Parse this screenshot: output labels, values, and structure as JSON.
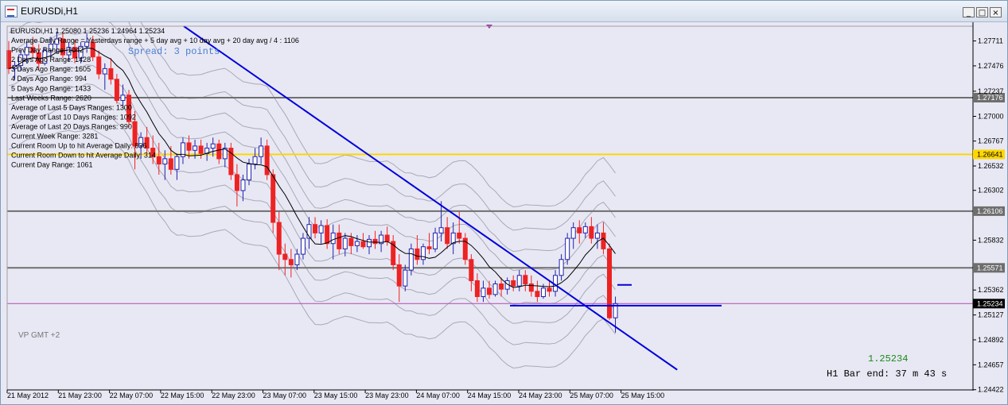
{
  "window": {
    "title": "EURUSDi,H1",
    "buttons": [
      "_",
      "□",
      "×"
    ]
  },
  "ohlc_line": "EURUSDi,H1  1.25080 1.25236 1.24964 1.25234",
  "info_lines": [
    "Average Daily Range = Yesterdays range + 5 day avg + 10 day avg + 20 day avg / 4 : 1106",
    "Prev Day Range: 1042",
    "2 Days Ago Range: 1428",
    "3 Days Ago Range: 1605",
    "4 Days Ago Range: 994",
    "5 Days Ago Range: 1433",
    "Last Weeks Range: 2620",
    "Average of Last 5 Days Ranges: 1300",
    "Average of Last 10 Days Ranges: 1092",
    "Average of Last 20 Days Ranges: 990",
    "Current Week Range: 3281",
    "Current Room Up to hit Average Daily:    836",
    "Current Room Down to hit Average Daily: 314",
    "Current Day Range: 1061"
  ],
  "spread_text": "Spread: 3 points",
  "vp_label": "VP GMT +2",
  "current_price_text": "1.25234",
  "bar_end_text": "H1 Bar end: 37 m 43 s",
  "colors": {
    "background": "#e8e8f4",
    "bull": "#2222aa",
    "bear": "#ee2222",
    "trendline": "#0000dd",
    "yellow_level": "#ffd700",
    "gray_level": "#6e6e6e",
    "bid_line": "#b04ab0",
    "price_text": "#1a8a1a"
  },
  "chart_data": {
    "type": "candlestick",
    "symbol": "EURUSDi",
    "timeframe": "H1",
    "ylim": [
      1.2442,
      1.2785
    ],
    "y_ticks": [
      "1.27711",
      "1.27476",
      "1.27237",
      "1.27000",
      "1.26767",
      "1.26532",
      "1.26302",
      "1.25832",
      "1.25362",
      "1.25127",
      "1.24892",
      "1.24657",
      "1.24422"
    ],
    "x_labels": [
      "21 May 2012",
      "21 May 23:00",
      "22 May 07:00",
      "22 May 15:00",
      "22 May 23:00",
      "23 May 07:00",
      "23 May 15:00",
      "23 May 23:00",
      "24 May 07:00",
      "24 May 15:00",
      "24 May 23:00",
      "25 May 07:00",
      "25 May 15:00"
    ],
    "horizontal_levels": [
      {
        "label": "1.27176",
        "value": 1.27176,
        "color": "gray"
      },
      {
        "label": "1.26641",
        "value": 1.26641,
        "color": "yellow"
      },
      {
        "label": "1.26106",
        "value": 1.26106,
        "color": "gray"
      },
      {
        "label": "1.25571",
        "value": 1.25571,
        "color": "gray"
      },
      {
        "label": "1.25234",
        "value": 1.25234,
        "color": "bid"
      }
    ],
    "bid": 1.25234,
    "trendline": [
      [
        0,
        1.2785
      ],
      [
        104,
        1.2461
      ]
    ],
    "candles": [
      [
        1.2762,
        1.2771,
        1.274,
        1.2745
      ],
      [
        1.2745,
        1.2752,
        1.2735,
        1.2748
      ],
      [
        1.2748,
        1.2762,
        1.2743,
        1.2758
      ],
      [
        1.2758,
        1.277,
        1.275,
        1.2765
      ],
      [
        1.2765,
        1.2775,
        1.2755,
        1.276
      ],
      [
        1.276,
        1.2768,
        1.2745,
        1.275
      ],
      [
        1.275,
        1.2765,
        1.2748,
        1.2762
      ],
      [
        1.2762,
        1.2775,
        1.2755,
        1.2768
      ],
      [
        1.2768,
        1.278,
        1.276,
        1.2773
      ],
      [
        1.2773,
        1.2779,
        1.2755,
        1.2758
      ],
      [
        1.2758,
        1.277,
        1.2752,
        1.2765
      ],
      [
        1.2765,
        1.2772,
        1.275,
        1.2755
      ],
      [
        1.2755,
        1.277,
        1.275,
        1.2766
      ],
      [
        1.2766,
        1.2778,
        1.276,
        1.277
      ],
      [
        1.277,
        1.2776,
        1.2752,
        1.2756
      ],
      [
        1.2756,
        1.2762,
        1.2735,
        1.274
      ],
      [
        1.274,
        1.275,
        1.2725,
        1.2745
      ],
      [
        1.2745,
        1.2755,
        1.273,
        1.2735
      ],
      [
        1.2735,
        1.274,
        1.2712,
        1.2715
      ],
      [
        1.2715,
        1.273,
        1.271,
        1.272
      ],
      [
        1.272,
        1.2725,
        1.269,
        1.2695
      ],
      [
        1.2695,
        1.2705,
        1.265,
        1.2672
      ],
      [
        1.2672,
        1.2685,
        1.266,
        1.268
      ],
      [
        1.268,
        1.269,
        1.2665,
        1.267
      ],
      [
        1.267,
        1.2682,
        1.2655,
        1.2662
      ],
      [
        1.2662,
        1.2675,
        1.2645,
        1.2655
      ],
      [
        1.2655,
        1.2668,
        1.264,
        1.266
      ],
      [
        1.266,
        1.2672,
        1.2645,
        1.265
      ],
      [
        1.265,
        1.2665,
        1.264,
        1.2662
      ],
      [
        1.2662,
        1.268,
        1.2655,
        1.2675
      ],
      [
        1.2675,
        1.2682,
        1.266,
        1.2668
      ],
      [
        1.2668,
        1.2678,
        1.266,
        1.2672
      ],
      [
        1.2672,
        1.2678,
        1.266,
        1.2665
      ],
      [
        1.2665,
        1.2675,
        1.2658,
        1.267
      ],
      [
        1.267,
        1.268,
        1.2662,
        1.2674
      ],
      [
        1.2674,
        1.2678,
        1.2655,
        1.266
      ],
      [
        1.266,
        1.2675,
        1.2652,
        1.267
      ],
      [
        1.267,
        1.2675,
        1.264,
        1.2645
      ],
      [
        1.2645,
        1.2655,
        1.2615,
        1.263
      ],
      [
        1.263,
        1.2645,
        1.262,
        1.264
      ],
      [
        1.264,
        1.266,
        1.2635,
        1.2655
      ],
      [
        1.2655,
        1.267,
        1.265,
        1.2662
      ],
      [
        1.2662,
        1.268,
        1.2655,
        1.2672
      ],
      [
        1.2672,
        1.2678,
        1.264,
        1.2645
      ],
      [
        1.2645,
        1.265,
        1.259,
        1.26
      ],
      [
        1.26,
        1.261,
        1.2555,
        1.257
      ],
      [
        1.257,
        1.258,
        1.255,
        1.2565
      ],
      [
        1.2565,
        1.2575,
        1.2548,
        1.256
      ],
      [
        1.256,
        1.2575,
        1.2555,
        1.257
      ],
      [
        1.257,
        1.259,
        1.2565,
        1.2585
      ],
      [
        1.2585,
        1.2605,
        1.2575,
        1.2598
      ],
      [
        1.2598,
        1.2605,
        1.2585,
        1.259
      ],
      [
        1.259,
        1.2602,
        1.258,
        1.2597
      ],
      [
        1.2597,
        1.2603,
        1.2575,
        1.258
      ],
      [
        1.258,
        1.2598,
        1.2565,
        1.259
      ],
      [
        1.259,
        1.2598,
        1.257,
        1.2575
      ],
      [
        1.2575,
        1.259,
        1.2568,
        1.2585
      ],
      [
        1.2585,
        1.259,
        1.257,
        1.2578
      ],
      [
        1.2578,
        1.2588,
        1.2572,
        1.2582
      ],
      [
        1.2582,
        1.259,
        1.2575,
        1.2577
      ],
      [
        1.2577,
        1.2588,
        1.257,
        1.2584
      ],
      [
        1.2584,
        1.2592,
        1.2575,
        1.258
      ],
      [
        1.258,
        1.2592,
        1.2572,
        1.2588
      ],
      [
        1.2588,
        1.2596,
        1.2578,
        1.2582
      ],
      [
        1.2582,
        1.2588,
        1.2555,
        1.256
      ],
      [
        1.256,
        1.257,
        1.2525,
        1.254
      ],
      [
        1.254,
        1.256,
        1.2535,
        1.2555
      ],
      [
        1.2555,
        1.258,
        1.255,
        1.2575
      ],
      [
        1.2575,
        1.2588,
        1.256,
        1.2565
      ],
      [
        1.2565,
        1.258,
        1.256,
        1.2577
      ],
      [
        1.2577,
        1.259,
        1.257,
        1.2575
      ],
      [
        1.2575,
        1.2595,
        1.2572,
        1.259
      ],
      [
        1.259,
        1.262,
        1.2582,
        1.2595
      ],
      [
        1.2595,
        1.2605,
        1.2575,
        1.258
      ],
      [
        1.258,
        1.26,
        1.257,
        1.259
      ],
      [
        1.259,
        1.261,
        1.258,
        1.2585
      ],
      [
        1.2585,
        1.259,
        1.256,
        1.2565
      ],
      [
        1.2565,
        1.257,
        1.2535,
        1.2545
      ],
      [
        1.2545,
        1.2552,
        1.2525,
        1.253
      ],
      [
        1.253,
        1.2545,
        1.2525,
        1.2538
      ],
      [
        1.2538,
        1.2545,
        1.2528,
        1.2532
      ],
      [
        1.2532,
        1.2545,
        1.253,
        1.2542
      ],
      [
        1.2542,
        1.2548,
        1.253,
        1.2537
      ],
      [
        1.2537,
        1.2548,
        1.2532,
        1.2545
      ],
      [
        1.2545,
        1.255,
        1.2535,
        1.254
      ],
      [
        1.254,
        1.2555,
        1.2535,
        1.255
      ],
      [
        1.255,
        1.2555,
        1.2535,
        1.2542
      ],
      [
        1.2542,
        1.255,
        1.253,
        1.2535
      ],
      [
        1.2535,
        1.2545,
        1.2525,
        1.253
      ],
      [
        1.253,
        1.2542,
        1.2528,
        1.2538
      ],
      [
        1.2538,
        1.2545,
        1.253,
        1.2535
      ],
      [
        1.2535,
        1.2555,
        1.253,
        1.255
      ],
      [
        1.255,
        1.257,
        1.2545,
        1.2565
      ],
      [
        1.2565,
        1.259,
        1.256,
        1.2585
      ],
      [
        1.2585,
        1.26,
        1.2575,
        1.2595
      ],
      [
        1.2595,
        1.2602,
        1.258,
        1.259
      ],
      [
        1.259,
        1.26,
        1.2585,
        1.2596
      ],
      [
        1.2596,
        1.2605,
        1.258,
        1.2585
      ],
      [
        1.2585,
        1.2598,
        1.2575,
        1.259
      ],
      [
        1.259,
        1.26,
        1.257,
        1.2575
      ],
      [
        1.2575,
        1.258,
        1.2508,
        1.251
      ],
      [
        1.251,
        1.253,
        1.2496,
        1.25234
      ]
    ]
  }
}
